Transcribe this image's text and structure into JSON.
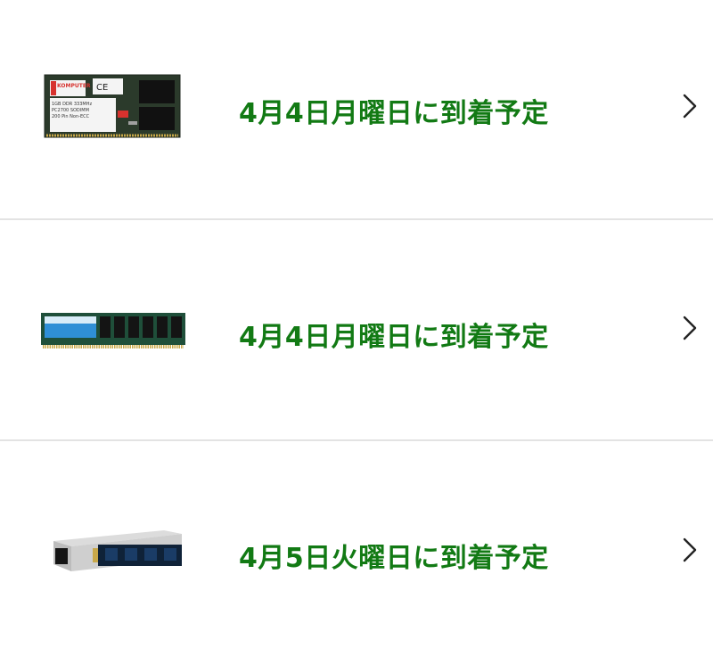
{
  "orders": [
    {
      "product_image": "sodimm-ram-module-image",
      "image_text": {
        "brand": "KOMPUTER BAY",
        "line1": "1GB DDR 333MHz",
        "line2": "PC2700 SODIMM",
        "line3": "200 Pin Non-ECC"
      },
      "delivery_text": "4月4日月曜日に到着予定",
      "chevron_icon": "chevron-right-icon"
    },
    {
      "product_image": "dimm-ram-module-image",
      "delivery_text": "4月4日月曜日に到着予定",
      "chevron_icon": "chevron-right-icon"
    },
    {
      "product_image": "nvme-ssd-module-image",
      "delivery_text": "4月5日火曜日に到着予定",
      "chevron_icon": "chevron-right-icon"
    }
  ],
  "colors": {
    "delivery_text": "#127a14",
    "divider": "#e3e3e3",
    "chevron": "#222222"
  }
}
